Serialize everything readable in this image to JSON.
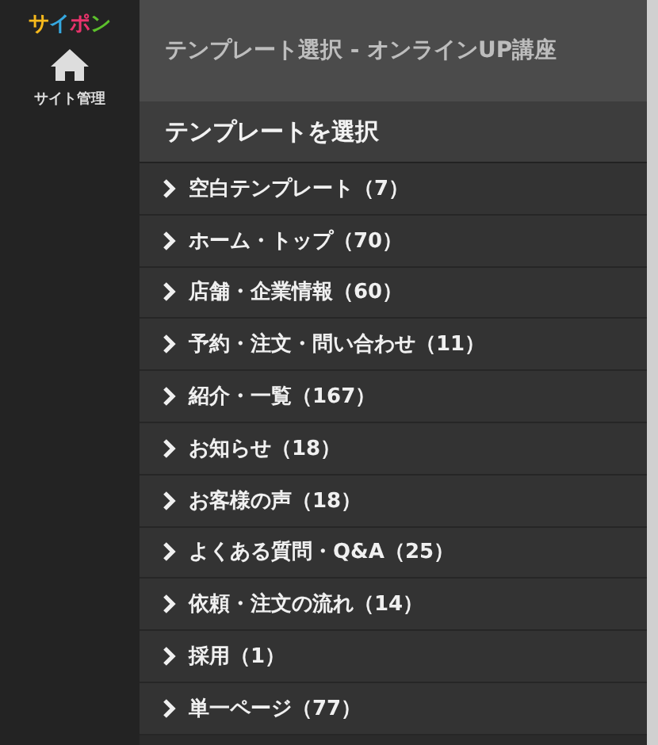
{
  "logo": [
    {
      "char": "サ",
      "color": "#f5b81c"
    },
    {
      "char": "イ",
      "color": "#35a8e0"
    },
    {
      "char": "ポ",
      "color": "#e8336b"
    },
    {
      "char": "ン",
      "color": "#5cc02c"
    }
  ],
  "sidebar": {
    "items": [
      {
        "label": "サイト管理"
      }
    ]
  },
  "window": {
    "title": "テンプレート選択 - オンラインUP講座"
  },
  "section": {
    "heading": "テンプレートを選択"
  },
  "categories": [
    {
      "label": "空白テンプレート（7）"
    },
    {
      "label": "ホーム・トップ（70）"
    },
    {
      "label": "店舗・企業情報（60）"
    },
    {
      "label": "予約・注文・問い合わせ（11）"
    },
    {
      "label": "紹介・一覧（167）"
    },
    {
      "label": "お知らせ（18）"
    },
    {
      "label": "お客様の声（18）"
    },
    {
      "label": "よくある質問・Q&A（25）"
    },
    {
      "label": "依頼・注文の流れ（14）"
    },
    {
      "label": "採用（1）"
    },
    {
      "label": "単一ページ（77）"
    }
  ]
}
